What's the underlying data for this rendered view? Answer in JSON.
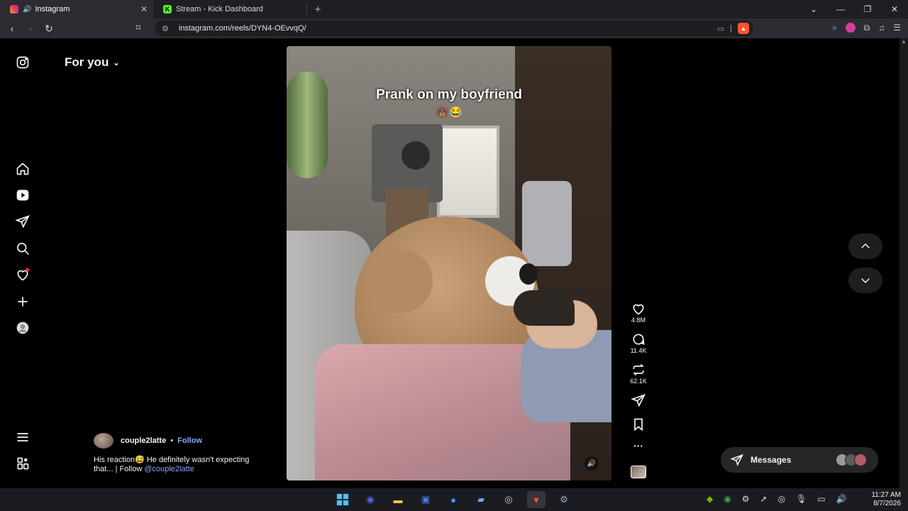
{
  "browser": {
    "tabs": [
      {
        "label": "Instagram",
        "active": true
      },
      {
        "label": "Stream - Kick Dashboard",
        "active": false
      }
    ],
    "new_tab": "+",
    "url": "instagram.com/reels/DYN4-OEvvqQ/",
    "window_controls": [
      "⌄",
      "—",
      "❐",
      "✕"
    ]
  },
  "sidebar": {
    "heading": "For you",
    "items": [
      "Instagram",
      "Home",
      "Reels",
      "Messages",
      "Search",
      "Notifications",
      "Create",
      "Profile",
      "More",
      "Also from Meta"
    ]
  },
  "reel": {
    "caption_title": "Prank on my boyfriend",
    "caption_emoji": "🐻😂",
    "likes": "4.8M",
    "comments": "11.4K",
    "reposts": "62.1K",
    "more": "···"
  },
  "post": {
    "username": "couple2latte",
    "separator": "•",
    "follow": "Follow",
    "description": "His reaction😅 He definitely wasn't expecting that... | Follow ",
    "mention": "@couple2latte"
  },
  "messages": {
    "label": "Messages"
  },
  "taskbar": {
    "time": "11:27 AM",
    "date": "8/7/2026"
  },
  "colors": {
    "accent_link": "#8aa7ff",
    "page_bg": "#000000",
    "notification_dot": "#ff3040"
  }
}
